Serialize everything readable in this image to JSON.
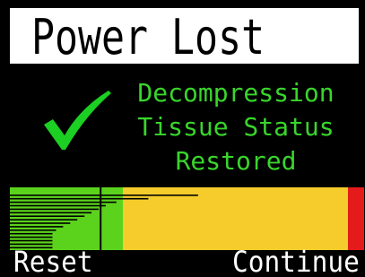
{
  "header": {
    "title": "Power Lost"
  },
  "message": {
    "lines": [
      "Decompression",
      "Tissue Status",
      "Restored"
    ]
  },
  "colors": {
    "background": "#000000",
    "title_bg": "#ffffff",
    "message": "#39d52c",
    "check": "#1ccf23",
    "zone_green": "#5bd31c",
    "zone_yellow": "#f5cc2b",
    "zone_red": "#e51b1b",
    "bars": "#000000"
  },
  "tissue_bar": {
    "zones": [
      {
        "name": "green",
        "fraction": 0.318
      },
      {
        "name": "yellow",
        "fraction": 0.633
      },
      {
        "name": "red",
        "fraction": 0.049
      }
    ],
    "marker_fraction": 0.253,
    "compartments": [
      0.53,
      0.39,
      0.3,
      0.27,
      0.25,
      0.23,
      0.21,
      0.19,
      0.17,
      0.15,
      0.13,
      0.12,
      0.12,
      0.12,
      0.12,
      0.12
    ]
  },
  "footer": {
    "reset_label": "Reset",
    "continue_label": "Continue"
  }
}
